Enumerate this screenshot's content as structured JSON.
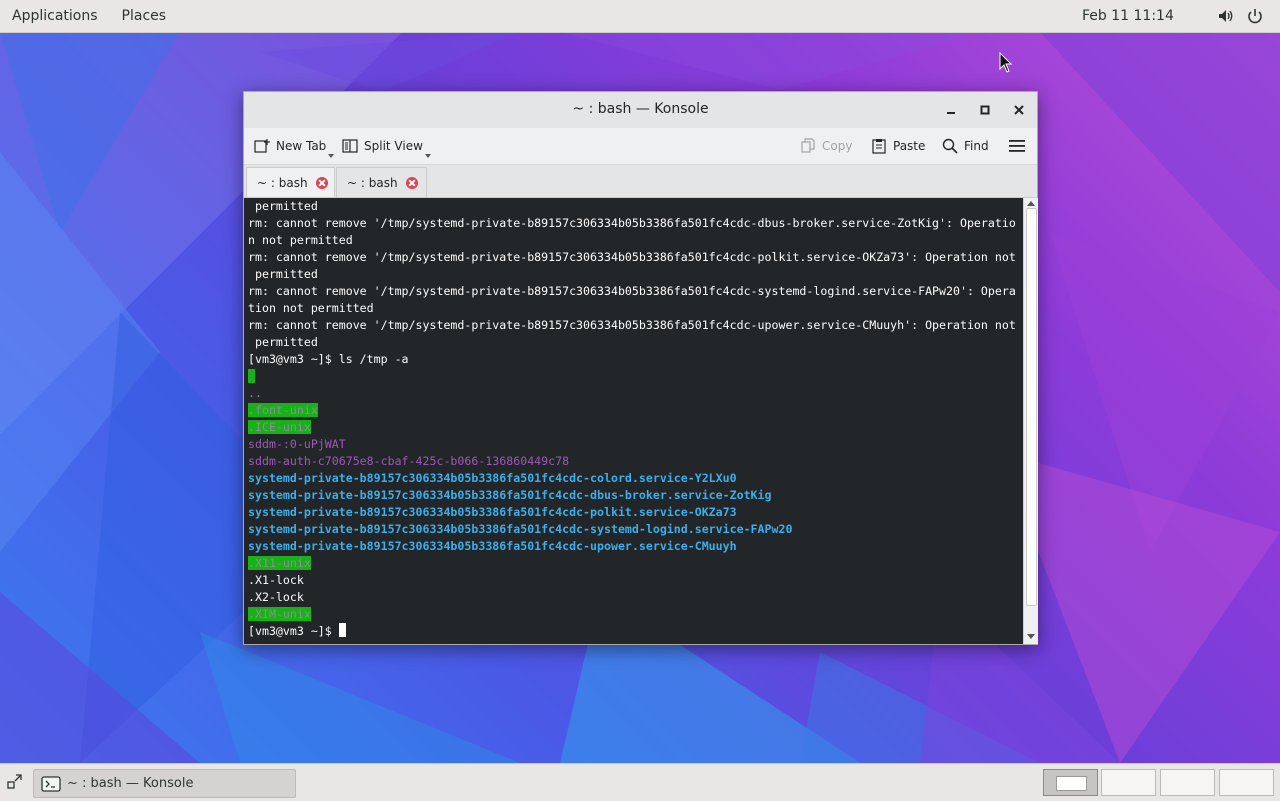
{
  "top_panel": {
    "applications": "Applications",
    "places": "Places",
    "clock": "Feb 11  11:14",
    "volume_icon": "speaker-icon",
    "power_icon": "power-icon"
  },
  "window": {
    "title": "~ : bash — Konsole",
    "toolbar": {
      "new_tab": "New Tab",
      "split_view": "Split View",
      "copy": "Copy",
      "paste": "Paste",
      "find": "Find"
    },
    "tabs": [
      {
        "label": "~ : bash",
        "active": true
      },
      {
        "label": "~ : bash",
        "active": false
      }
    ],
    "terminal_lines": [
      " permitted",
      "rm: cannot remove '/tmp/systemd-private-b89157c306334b05b3386fa501fc4cdc-dbus-broker.service-ZotKig': Operatio",
      "n not permitted",
      "rm: cannot remove '/tmp/systemd-private-b89157c306334b05b3386fa501fc4cdc-polkit.service-OKZa73': Operation not",
      " permitted",
      "rm: cannot remove '/tmp/systemd-private-b89157c306334b05b3386fa501fc4cdc-systemd-logind.service-FAPw20': Opera",
      "tion not permitted",
      "rm: cannot remove '/tmp/systemd-private-b89157c306334b05b3386fa501fc4cdc-upower.service-CMuuyh': Operation not",
      " permitted",
      "[vm3@vm3 ~]$ ls /tmp -a",
      ".",
      "..",
      ".font-unix",
      ".ICE-unix",
      "sddm-:0-uPjWAT",
      "sddm-auth-c70675e8-cbaf-425c-b066-136860449c78",
      "systemd-private-b89157c306334b05b3386fa501fc4cdc-colord.service-Y2LXu0",
      "systemd-private-b89157c306334b05b3386fa501fc4cdc-dbus-broker.service-ZotKig",
      "systemd-private-b89157c306334b05b3386fa501fc4cdc-polkit.service-OKZa73",
      "systemd-private-b89157c306334b05b3386fa501fc4cdc-systemd-logind.service-FAPw20",
      "systemd-private-b89157c306334b05b3386fa501fc4cdc-upower.service-CMuuyh",
      ".X11-unix",
      ".X1-lock",
      ".X2-lock",
      ".XIM-unix",
      "[vm3@vm3 ~]$ "
    ]
  },
  "taskbar": {
    "task_label": "~ : bash — Konsole",
    "workspace_count": 4,
    "active_workspace": 1
  }
}
